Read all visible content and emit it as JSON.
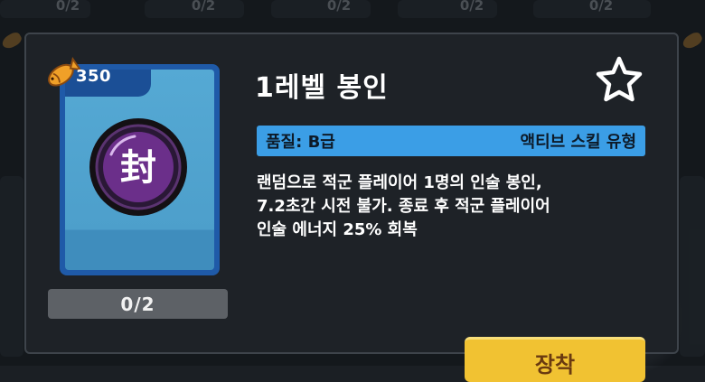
{
  "background": {
    "counts": [
      "0/2",
      "0/2",
      "0/2",
      "0/2",
      "0/2"
    ]
  },
  "item": {
    "cost": "350",
    "cost_icon": "fish-coin-icon",
    "emblem_char": "封",
    "owned_count": "0/2",
    "title": "1레벨 봉인",
    "quality": "품질: B급",
    "skill_type": "액티브 스킬 유형",
    "description_lines": [
      "랜덤으로 적군 플레이어 1명의 인술 봉인,",
      "7.2초간 시전 불가. 종료 후 적군 플레이어",
      "인술 에너지 25% 회복"
    ]
  },
  "actions": {
    "buy_label": "장착",
    "favorite_icon": "star-icon"
  },
  "colors": {
    "card_blue": "#4d9fcb",
    "quality_bar": "#3b9ee6",
    "button_yellow": "#f1c232",
    "orb_purple": "#6b2f8a"
  }
}
